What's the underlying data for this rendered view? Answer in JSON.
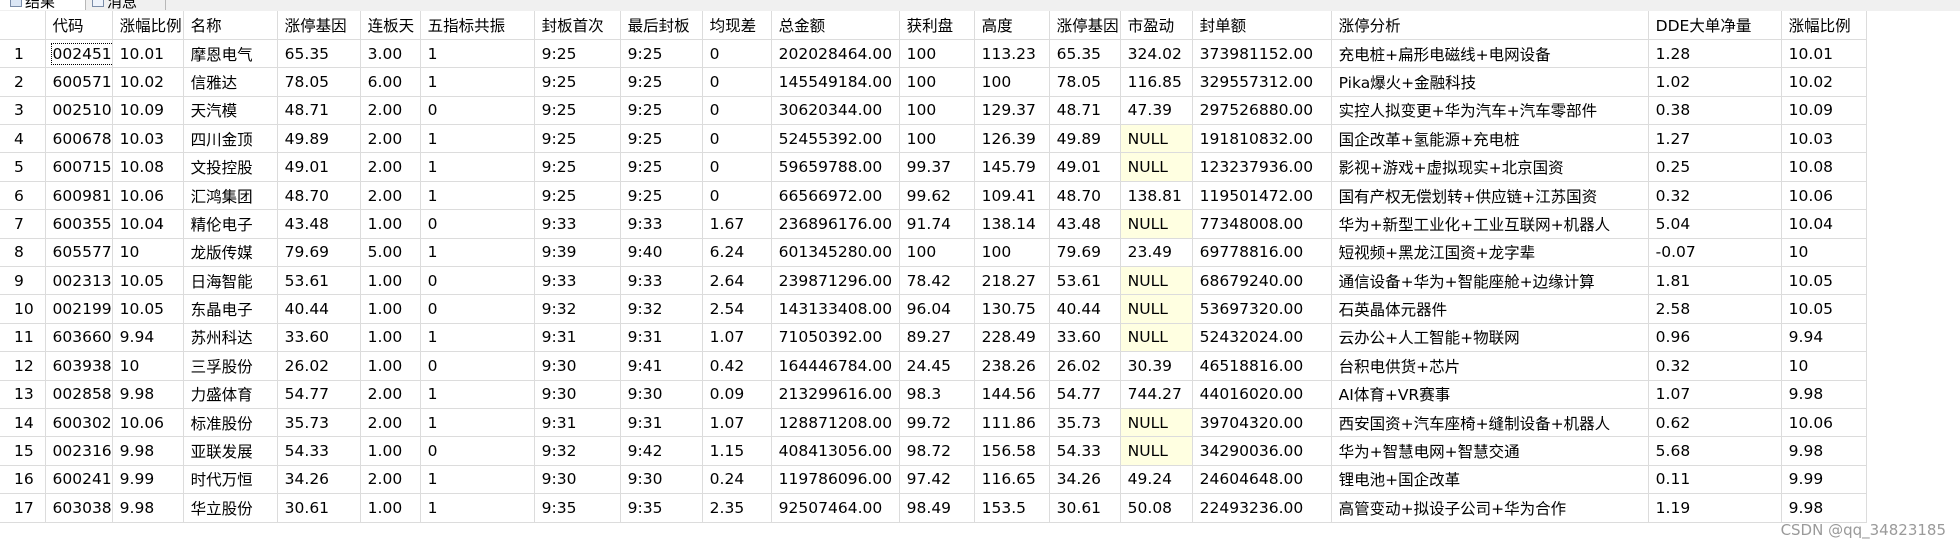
{
  "tabs": [
    {
      "label": "结果",
      "icon": "results-grid-icon"
    },
    {
      "label": "消息",
      "icon": "messages-icon"
    }
  ],
  "columns": [
    "代码",
    "涨幅比例",
    "名称",
    "涨停基因",
    "连板天",
    "五指标共振",
    "封板首次",
    "最后封板",
    "均现差",
    "总金额",
    "获利盘",
    "高度",
    "涨停基因",
    "市盈动",
    "封单额",
    "涨停分析",
    "DDE大单净量",
    "涨幅比例"
  ],
  "rows": [
    [
      "1",
      "002451",
      "10.01",
      "摩恩电气",
      "65.35",
      "3.00",
      "1",
      "9:25",
      "9:25",
      "0",
      "202028464.00",
      "100",
      "113.23",
      "65.35",
      "324.02",
      "373981152.00",
      "充电桩+扁形电磁线+电网设备",
      "1.28",
      "10.01"
    ],
    [
      "2",
      "600571",
      "10.02",
      "信雅达",
      "78.05",
      "6.00",
      "1",
      "9:25",
      "9:25",
      "0",
      "145549184.00",
      "100",
      "100",
      "78.05",
      "116.85",
      "329557312.00",
      "Pika爆火+金融科技",
      "1.02",
      "10.02"
    ],
    [
      "3",
      "002510",
      "10.09",
      "天汽模",
      "48.71",
      "2.00",
      "0",
      "9:25",
      "9:25",
      "0",
      "30620344.00",
      "100",
      "129.37",
      "48.71",
      "47.39",
      "297526880.00",
      "实控人拟变更+华为汽车+汽车零部件",
      "0.38",
      "10.09"
    ],
    [
      "4",
      "600678",
      "10.03",
      "四川金顶",
      "49.89",
      "2.00",
      "1",
      "9:25",
      "9:25",
      "0",
      "52455392.00",
      "100",
      "126.39",
      "49.89",
      "NULL",
      "191810832.00",
      "国企改革+氢能源+充电桩",
      "1.27",
      "10.03"
    ],
    [
      "5",
      "600715",
      "10.08",
      "文投控股",
      "49.01",
      "2.00",
      "1",
      "9:25",
      "9:25",
      "0",
      "59659788.00",
      "99.37",
      "145.79",
      "49.01",
      "NULL",
      "123237936.00",
      "影视+游戏+虚拟现实+北京国资",
      "0.25",
      "10.08"
    ],
    [
      "6",
      "600981",
      "10.06",
      "汇鸿集团",
      "48.70",
      "2.00",
      "1",
      "9:25",
      "9:25",
      "0",
      "66566972.00",
      "99.62",
      "109.41",
      "48.70",
      "138.81",
      "119501472.00",
      "国有产权无偿划转+供应链+江苏国资",
      "0.32",
      "10.06"
    ],
    [
      "7",
      "600355",
      "10.04",
      "精伦电子",
      "43.48",
      "1.00",
      "0",
      "9:33",
      "9:33",
      "1.67",
      "236896176.00",
      "91.74",
      "138.14",
      "43.48",
      "NULL",
      "77348008.00",
      "华为+新型工业化+工业互联网+机器人",
      "5.04",
      "10.04"
    ],
    [
      "8",
      "605577",
      "10",
      "龙版传媒",
      "79.69",
      "5.00",
      "1",
      "9:39",
      "9:40",
      "6.24",
      "601345280.00",
      "100",
      "100",
      "79.69",
      "23.49",
      "69778816.00",
      "短视频+黑龙江国资+龙字辈",
      "-0.07",
      "10"
    ],
    [
      "9",
      "002313",
      "10.05",
      "日海智能",
      "53.61",
      "1.00",
      "0",
      "9:33",
      "9:33",
      "2.64",
      "239871296.00",
      "78.42",
      "218.27",
      "53.61",
      "NULL",
      "68679240.00",
      "通信设备+华为+智能座舱+边缘计算",
      "1.81",
      "10.05"
    ],
    [
      "10",
      "002199",
      "10.05",
      "东晶电子",
      "40.44",
      "1.00",
      "0",
      "9:32",
      "9:32",
      "2.54",
      "143133408.00",
      "96.04",
      "130.75",
      "40.44",
      "NULL",
      "53697320.00",
      "石英晶体元器件",
      "2.58",
      "10.05"
    ],
    [
      "11",
      "603660",
      "9.94",
      "苏州科达",
      "33.60",
      "1.00",
      "1",
      "9:31",
      "9:31",
      "1.07",
      "71050392.00",
      "89.27",
      "228.49",
      "33.60",
      "NULL",
      "52432024.00",
      "云办公+人工智能+物联网",
      "0.96",
      "9.94"
    ],
    [
      "12",
      "603938",
      "10",
      "三孚股份",
      "26.02",
      "1.00",
      "0",
      "9:30",
      "9:41",
      "0.42",
      "164446784.00",
      "24.45",
      "238.26",
      "26.02",
      "30.39",
      "46518816.00",
      "台积电供货+芯片",
      "0.32",
      "10"
    ],
    [
      "13",
      "002858",
      "9.98",
      "力盛体育",
      "54.77",
      "2.00",
      "1",
      "9:30",
      "9:30",
      "0.09",
      "213299616.00",
      "98.3",
      "144.56",
      "54.77",
      "744.27",
      "44016020.00",
      "AI体育+VR赛事",
      "1.07",
      "9.98"
    ],
    [
      "14",
      "600302",
      "10.06",
      "标准股份",
      "35.73",
      "2.00",
      "1",
      "9:31",
      "9:31",
      "1.07",
      "128871208.00",
      "99.72",
      "111.86",
      "35.73",
      "NULL",
      "39704320.00",
      "西安国资+汽车座椅+缝制设备+机器人",
      "0.62",
      "10.06"
    ],
    [
      "15",
      "002316",
      "9.98",
      "亚联发展",
      "54.33",
      "1.00",
      "0",
      "9:32",
      "9:42",
      "1.15",
      "408413056.00",
      "98.72",
      "156.58",
      "54.33",
      "NULL",
      "34290036.00",
      "华为+智慧电网+智慧交通",
      "5.68",
      "9.98"
    ],
    [
      "16",
      "600241",
      "9.99",
      "时代万恒",
      "34.26",
      "2.00",
      "1",
      "9:30",
      "9:30",
      "0.24",
      "119786096.00",
      "97.42",
      "116.65",
      "34.26",
      "49.24",
      "24604648.00",
      "锂电池+国企改革",
      "0.11",
      "9.99"
    ],
    [
      "17",
      "603038",
      "9.98",
      "华立股份",
      "30.61",
      "1.00",
      "1",
      "9:35",
      "9:35",
      "2.35",
      "92507464.00",
      "98.49",
      "153.5",
      "30.61",
      "50.08",
      "22493236.00",
      "高管变动+拟设子公司+华为合作",
      "1.19",
      "9.98"
    ]
  ],
  "watermark": "CSDN @qq_34823185",
  "colors": {
    "null_highlight": "#ffffe1",
    "grid_line": "#dcdcdc",
    "watermark": "#9a9a9a"
  }
}
